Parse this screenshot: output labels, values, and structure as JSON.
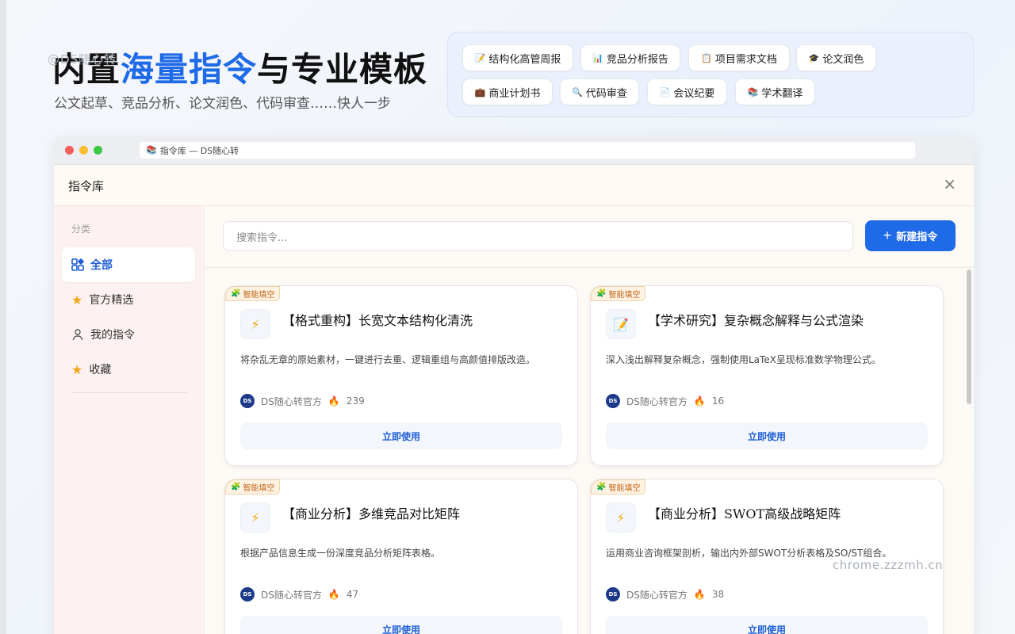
{
  "hero": {
    "watermark": "@DS随心转",
    "title_prefix": "内置",
    "title_highlight": "海量指令",
    "title_suffix": "与专业模板",
    "subtitle": "公文起草、竞品分析、论文润色、代码审查……快人一步"
  },
  "chips": [
    {
      "icon": "📝",
      "label": "结构化高管周报"
    },
    {
      "icon": "📊",
      "label": "竞品分析报告"
    },
    {
      "icon": "📋",
      "label": "项目需求文档"
    },
    {
      "icon": "🎓",
      "label": "论文润色"
    },
    {
      "icon": "💼",
      "label": "商业计划书"
    },
    {
      "icon": "🔍",
      "label": "代码审查"
    },
    {
      "icon": "📄",
      "label": "会议纪要"
    },
    {
      "icon": "📚",
      "label": "学术翻译"
    }
  ],
  "window": {
    "tab_icon": "📚",
    "tab_title": "指令库 — DS随心转"
  },
  "modal": {
    "title": "指令库",
    "close": "×"
  },
  "sidebar": {
    "category_label": "分类",
    "items": [
      {
        "icon": "grid-icon",
        "label": "全部"
      },
      {
        "icon": "star-icon",
        "label": "官方精选"
      },
      {
        "icon": "user-icon",
        "label": "我的指令"
      },
      {
        "icon": "star-icon",
        "label": "收藏"
      }
    ]
  },
  "toolbar": {
    "search_placeholder": "搜索指令...",
    "new_button": "新建指令",
    "new_icon": "+"
  },
  "badge_label": "智能填空",
  "cards": [
    {
      "icon": "⚡",
      "title": "【格式重构】长宽文本结构化清洗",
      "desc": "将杂乱无章的原始素材，一键进行去重、逻辑重组与高颜值排版改造。",
      "author": "DS随心转官方",
      "count": "239",
      "button": "立即使用"
    },
    {
      "icon": "📝",
      "title": "【学术研究】复杂概念解释与公式渲染",
      "desc": "深入浅出解释复杂概念，强制使用LaTeX呈现标准数学物理公式。",
      "author": "DS随心转官方",
      "count": "16",
      "button": "立即使用"
    },
    {
      "icon": "⚡",
      "title": "【商业分析】多维竞品对比矩阵",
      "desc": "根据产品信息生成一份深度竞品分析矩阵表格。",
      "author": "DS随心转官方",
      "count": "47",
      "button": "立即使用"
    },
    {
      "icon": "⚡",
      "title": "【商业分析】SWOT高级战略矩阵",
      "desc": "运用商业咨询框架剖析，输出内外部SWOT分析表格及SO/ST组合。",
      "author": "DS随心转官方",
      "count": "38",
      "button": "立即使用"
    }
  ],
  "avatar_text": "DS",
  "watermark_br": "chrome.zzzmh.cn",
  "colors": {
    "accent": "#1f6ae6",
    "badge": "#c0661a",
    "star": "#f0a818"
  }
}
